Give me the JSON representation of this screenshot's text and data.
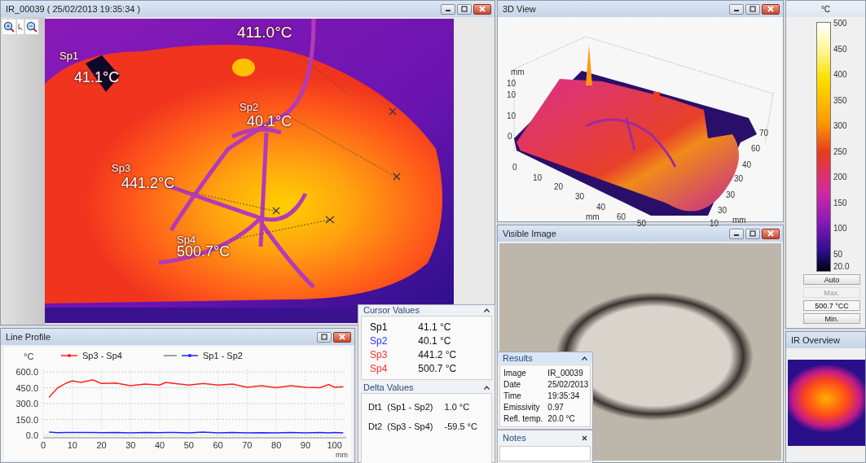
{
  "ir_window": {
    "title": "IR_00039 ( 25/02/2013 19:35:34 )",
    "max_label": "411.0°C",
    "spots": [
      {
        "name": "Sp1",
        "value": "41.1°C"
      },
      {
        "name": "Sp2",
        "value": "40.1°C"
      },
      {
        "name": "Sp3",
        "value": "441.2°C"
      },
      {
        "name": "Sp4",
        "value": "500.7°C"
      }
    ]
  },
  "view_3d": {
    "title": "3D View",
    "z_axis_labels": [
      "mm",
      "10",
      "10",
      "10",
      "0"
    ],
    "x_axis_labels": [
      "0",
      "10",
      "20",
      "30",
      "40",
      "mm",
      "60",
      "50"
    ],
    "y_axis_labels": [
      "70",
      "60",
      "40",
      "30",
      "30",
      "30",
      "10",
      "mm"
    ]
  },
  "line_profile": {
    "title": "Line Profile",
    "chart_data": {
      "type": "line",
      "grid": true,
      "legend": true,
      "xlabel": "mm",
      "ylabel": "°C",
      "xlim": [
        0,
        104
      ],
      "ylim": [
        0,
        600
      ],
      "xticks": [
        0,
        10,
        20,
        30,
        40,
        50,
        60,
        70,
        80,
        90,
        100
      ],
      "yticks": [
        {
          "value": 0,
          "label": "0.0"
        },
        {
          "value": 150,
          "label": "150.0"
        },
        {
          "value": 300,
          "label": "300.0"
        },
        {
          "value": 450,
          "label": "450.0"
        },
        {
          "value": 600,
          "label": "600.0"
        }
      ],
      "x": [
        2,
        5,
        8,
        10,
        13,
        17,
        20,
        25,
        30,
        35,
        40,
        42,
        45,
        50,
        55,
        60,
        65,
        70,
        75,
        80,
        85,
        90,
        95,
        98,
        100,
        103
      ],
      "series": [
        {
          "name": "Sp3 - Sp4",
          "color": "#ff2020",
          "values": [
            360,
            450,
            495,
            515,
            500,
            525,
            490,
            495,
            470,
            485,
            475,
            500,
            490,
            475,
            490,
            475,
            485,
            455,
            470,
            450,
            470,
            455,
            450,
            480,
            455,
            460
          ]
        },
        {
          "name": "Sp1 - Sp2",
          "color": "#2020ff",
          "values": [
            30,
            25,
            28,
            27,
            26,
            27,
            25,
            28,
            22,
            28,
            25,
            26,
            27,
            24,
            30,
            24,
            28,
            22,
            25,
            24,
            27,
            24,
            26,
            24,
            26,
            24
          ]
        }
      ]
    }
  },
  "cursor_values": {
    "title": "Cursor Values",
    "rows": [
      {
        "name": "Sp1",
        "value": "41.1 °C",
        "color": "#000000"
      },
      {
        "name": "Sp2",
        "value": "40.1 °C",
        "color": "#3333ff"
      },
      {
        "name": "Sp3",
        "value": "441.2 °C",
        "color": "#ff2a2a"
      },
      {
        "name": "Sp4",
        "value": "500.7 °C",
        "color": "#ff2a2a"
      }
    ]
  },
  "delta_values": {
    "title": "Delta Values",
    "rows": [
      {
        "name": "Dt1  (Sp1 - Sp2)",
        "value": "1.0 °C"
      },
      {
        "name": "Dt2  (Sp3 - Sp4)",
        "value": "-59.5 °C"
      }
    ]
  },
  "visible_image": {
    "title": "Visible Image"
  },
  "results": {
    "title": "Results",
    "rows": [
      {
        "label": "Image",
        "value": "IR_00039"
      },
      {
        "label": "Date",
        "value": "25/02/2013"
      },
      {
        "label": "Time",
        "value": "19:35:34"
      },
      {
        "label": "Emissivity",
        "value": "0.97"
      },
      {
        "label": "Refl. temp.",
        "value": "20.0 °C"
      }
    ]
  },
  "notes": {
    "title": "Notes"
  },
  "color_scale": {
    "unit": "°C",
    "ticks": [
      "500",
      "450",
      "400",
      "350",
      "300",
      "250",
      "200",
      "150",
      "100",
      "50",
      "20.0"
    ],
    "controls": [
      {
        "kind": "button",
        "label": "Auto",
        "disabled": false
      },
      {
        "kind": "button",
        "label": "Max.",
        "disabled": true
      },
      {
        "kind": "field",
        "value": "500.7 °CC"
      },
      {
        "kind": "button",
        "label": "Min.",
        "disabled": false
      }
    ]
  },
  "ir_overview": {
    "title": "IR Overview"
  }
}
